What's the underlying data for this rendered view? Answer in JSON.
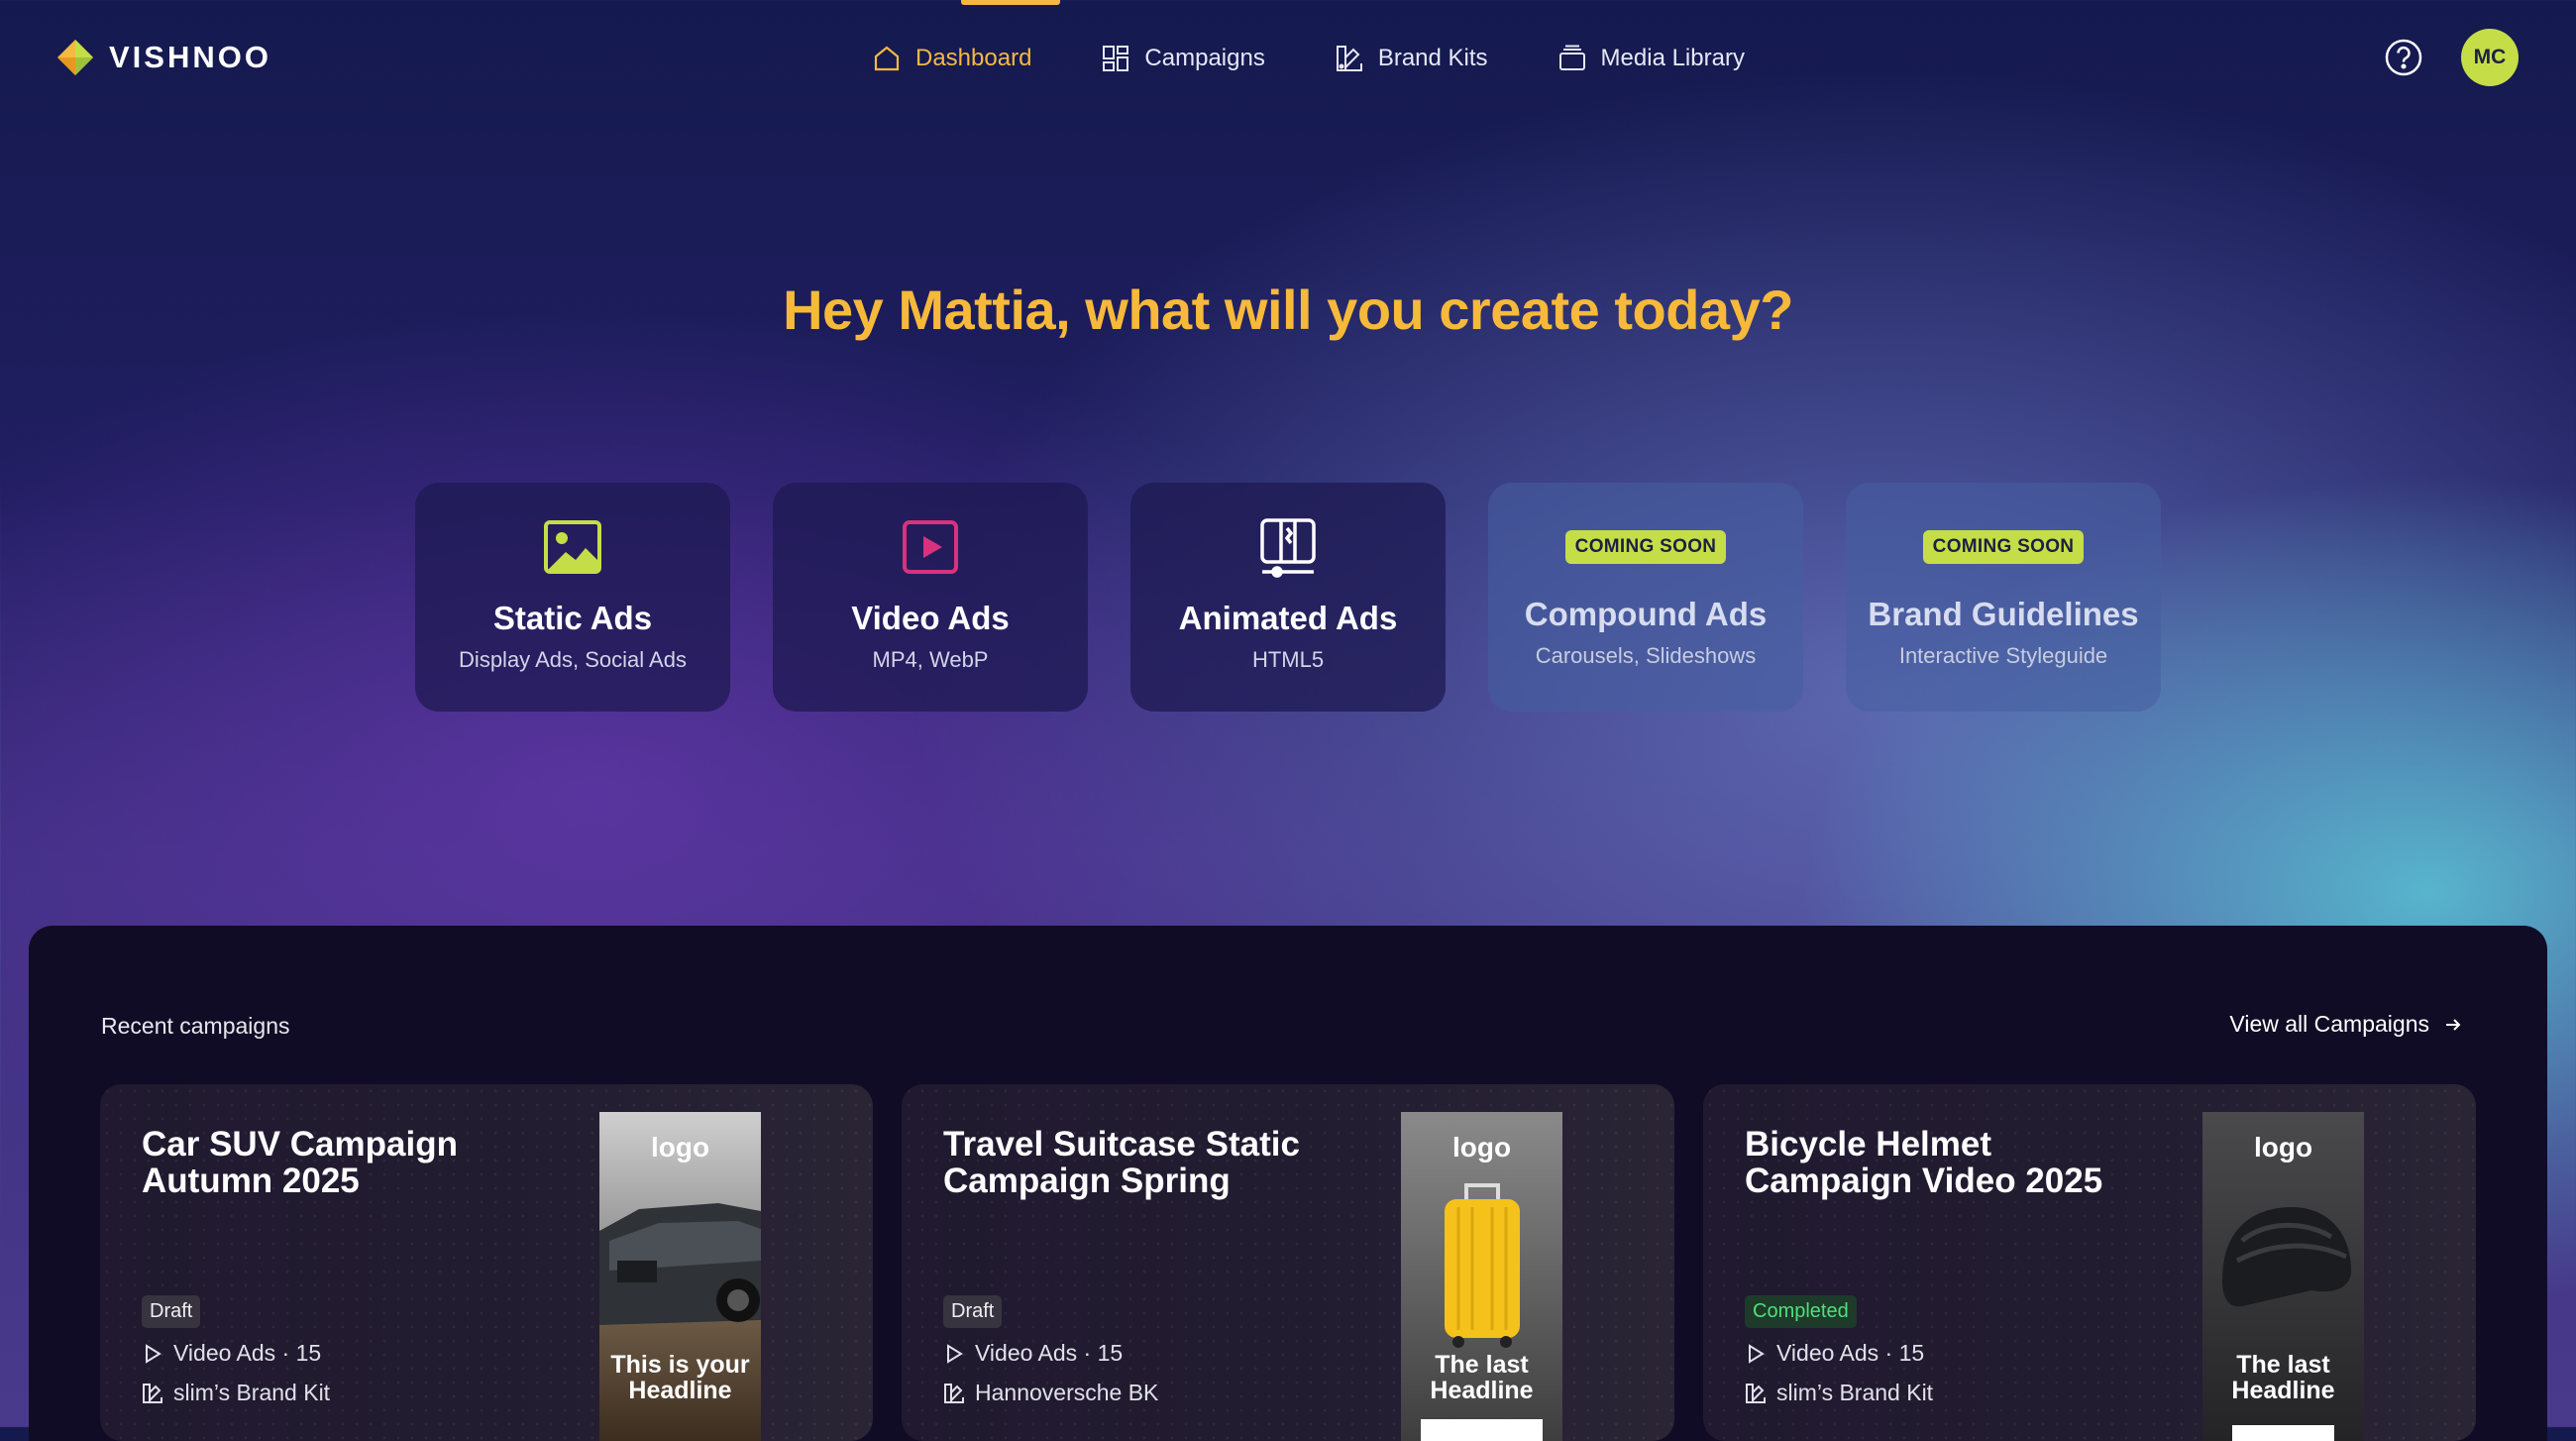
{
  "brand": {
    "name": "VISHNOO"
  },
  "nav": {
    "items": [
      {
        "label": "Dashboard",
        "icon": "home-icon",
        "active": true
      },
      {
        "label": "Campaigns",
        "icon": "grid-icon"
      },
      {
        "label": "Brand Kits",
        "icon": "swatch-icon"
      },
      {
        "label": "Media Library",
        "icon": "stack-icon"
      }
    ]
  },
  "user": {
    "initials": "MC"
  },
  "greeting": "Hey Mattia, what will you create today?",
  "tiles": [
    {
      "title": "Static Ads",
      "subtitle": "Display Ads, Social Ads",
      "icon": "image-icon"
    },
    {
      "title": "Video Ads",
      "subtitle": "MP4, WebP",
      "icon": "play-icon"
    },
    {
      "title": "Animated Ads",
      "subtitle": "HTML5",
      "icon": "animation-icon"
    },
    {
      "title": "Compound Ads",
      "subtitle": "Carousels, Slideshows",
      "badge": "COMING SOON"
    },
    {
      "title": "Brand Guidelines",
      "subtitle": "Interactive Styleguide",
      "badge": "COMING SOON"
    }
  ],
  "recent": {
    "title": "Recent campaigns",
    "view_all": "View all Campaigns",
    "campaigns": [
      {
        "title": "Car SUV Campaign Autumn 2025",
        "status": "Draft",
        "type": "Video Ads · 15",
        "brand_kit": "slim’s Brand Kit",
        "thumb_logo": "logo",
        "thumb_headline": "This is your Headline"
      },
      {
        "title": "Travel Suitcase Static Campaign Spring",
        "status": "Draft",
        "type": "Video Ads · 15",
        "brand_kit": "Hannoversche BK",
        "thumb_logo": "logo",
        "thumb_headline": "The last Headline"
      },
      {
        "title": "Bicycle Helmet Campaign Video 2025",
        "status": "Completed",
        "type": "Video Ads · 15",
        "brand_kit": "slim’s Brand Kit",
        "thumb_logo": "logo",
        "thumb_headline": "The last Headline"
      }
    ]
  },
  "colors": {
    "accent": "#f5b942",
    "lime": "#c5dd47",
    "magenta": "#d8327e",
    "completed": "#4ee07a"
  }
}
